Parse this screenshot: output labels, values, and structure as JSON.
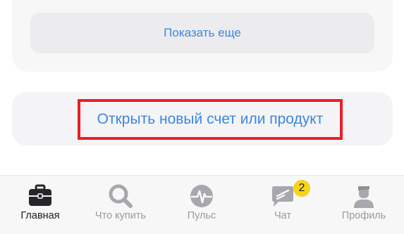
{
  "accounts": {
    "show_more_label": "Показать еще"
  },
  "open_product": {
    "label": "Открыть новый счет или продукт"
  },
  "tabbar": {
    "tabs": [
      {
        "id": "home",
        "label": "Главная",
        "icon": "briefcase-icon",
        "active": true
      },
      {
        "id": "buy",
        "label": "Что купить",
        "icon": "search-icon",
        "active": false
      },
      {
        "id": "pulse",
        "label": "Пульс",
        "icon": "pulse-icon",
        "active": false
      },
      {
        "id": "chat",
        "label": "Чат",
        "icon": "chat-icon",
        "active": false
      },
      {
        "id": "profile",
        "label": "Профиль",
        "icon": "profile-icon",
        "active": false
      }
    ],
    "chat_badge": "2"
  },
  "colors": {
    "link": "#3d86e0",
    "highlight": "#ee1c25",
    "badge": "#f6d41a",
    "icon_inactive": "#a7a7ad",
    "icon_active": "#26262a"
  }
}
